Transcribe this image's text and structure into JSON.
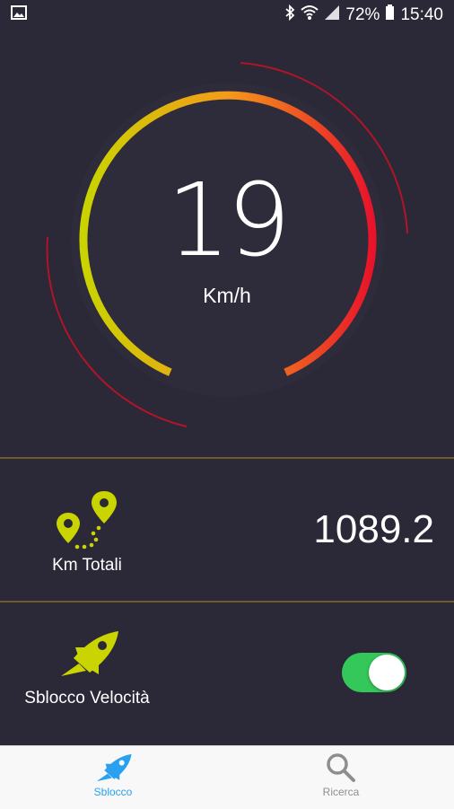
{
  "status_bar": {
    "battery": "72%",
    "time": "15:40",
    "icons": [
      "image-icon",
      "bluetooth-icon",
      "wifi-icon",
      "signal-icon",
      "battery-icon"
    ]
  },
  "gauge": {
    "speed": "19",
    "unit": "Km/h",
    "colors": {
      "start": "#c9d400",
      "end": "#e8132a"
    }
  },
  "total_km": {
    "label": "Km Totali",
    "value": "1089.2",
    "icon": "route-pins-icon",
    "icon_color": "#c9d400"
  },
  "speed_unlock": {
    "label": "Sblocco Velocità",
    "icon": "rocket-icon",
    "toggle_on": true,
    "toggle_color": "#34c759"
  },
  "bottom_nav": {
    "items": [
      {
        "label": "Sblocco",
        "icon": "rocket-icon",
        "active": true,
        "color": "#2aa0f0"
      },
      {
        "label": "Ricerca",
        "icon": "search-icon",
        "active": false,
        "color": "#8e8e8e"
      }
    ]
  }
}
